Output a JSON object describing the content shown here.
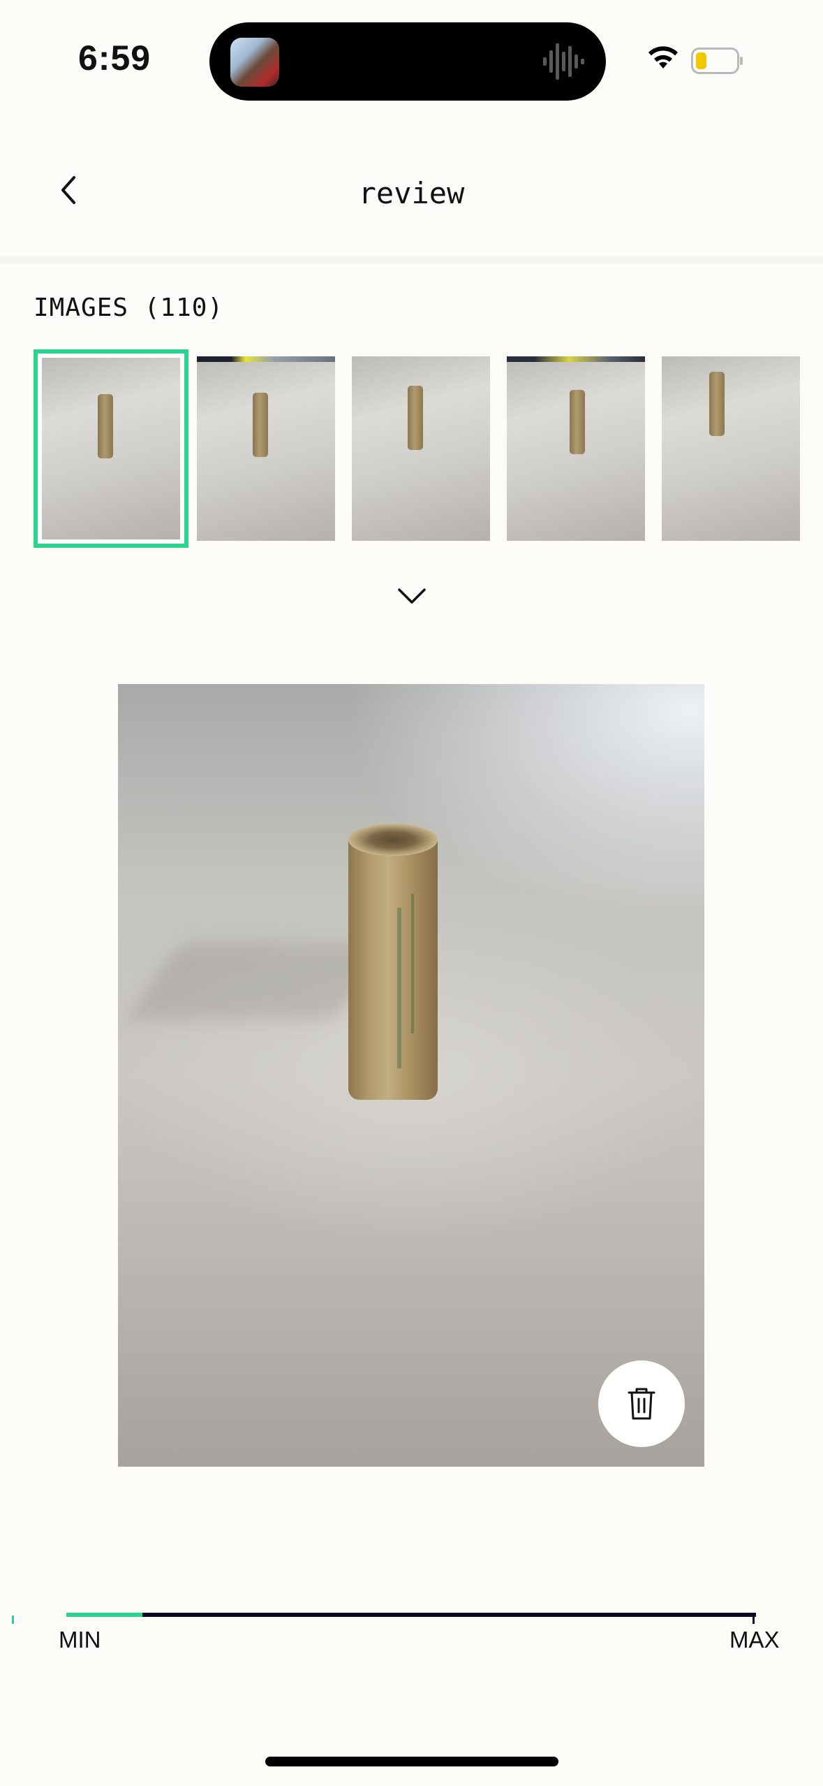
{
  "status_bar": {
    "time": "6:59"
  },
  "header": {
    "title": "review"
  },
  "images": {
    "heading": "IMAGES (110)"
  },
  "slider": {
    "min_label": "MIN",
    "max_label": "MAX",
    "value_fraction": 0.11
  },
  "colors": {
    "accent": "#2bd38f",
    "track": "#0d0b22",
    "background": "#fdfcf9"
  },
  "icons": {
    "back": "chevron-left-icon",
    "expand": "chevron-down-icon",
    "delete": "trash-icon"
  }
}
